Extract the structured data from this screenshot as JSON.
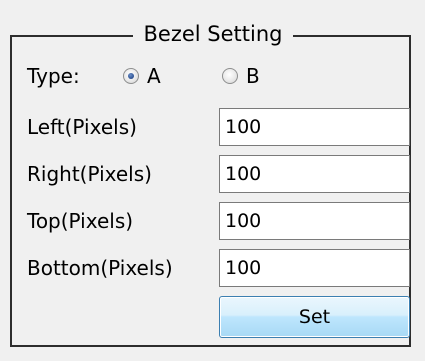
{
  "group": {
    "title": "Bezel Setting"
  },
  "type_row": {
    "label": "Type:",
    "options": [
      {
        "label": "A",
        "checked": true
      },
      {
        "label": "B",
        "checked": false
      }
    ]
  },
  "fields": [
    {
      "label": "Left(Pixels)",
      "value": "100"
    },
    {
      "label": "Right(Pixels)",
      "value": "100"
    },
    {
      "label": "Top(Pixels)",
      "value": "100"
    },
    {
      "label": "Bottom(Pixels)",
      "value": "100"
    }
  ],
  "set_button": {
    "label": "Set"
  }
}
